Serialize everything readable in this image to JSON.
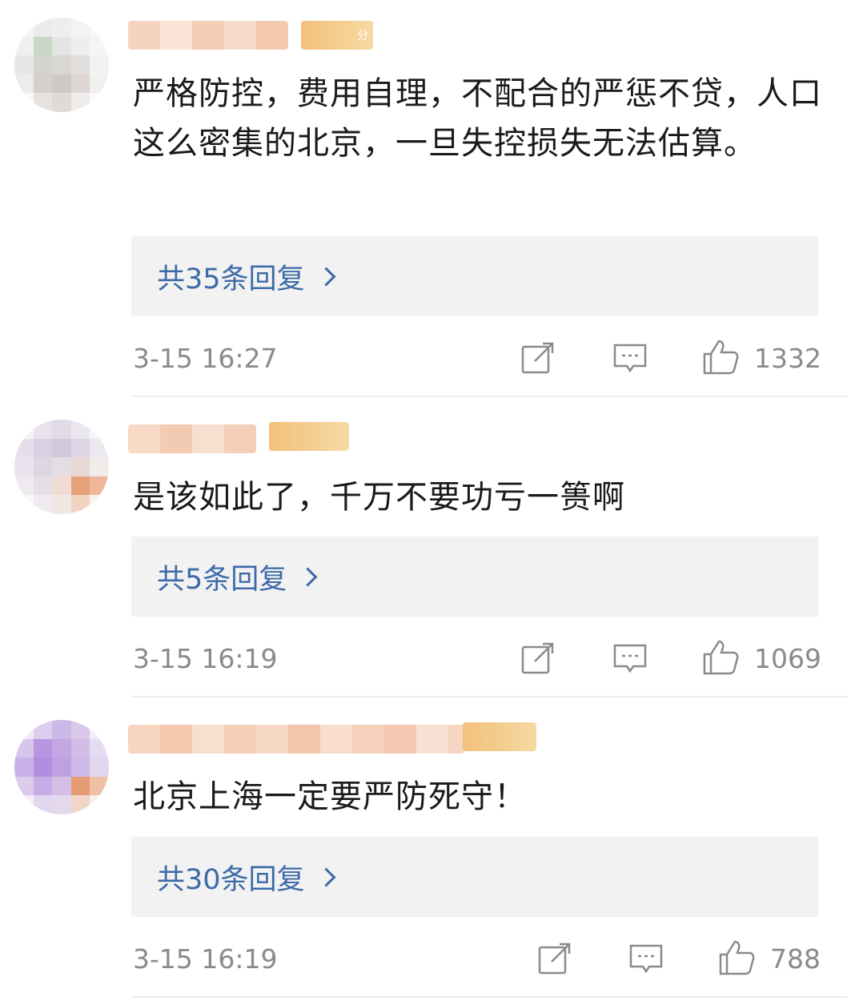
{
  "comments": [
    {
      "text": "严格防控，费用自理，不配合的严惩不贷，人口这么密集的北京，一旦失控损失无法估算。",
      "badge_text": "分",
      "replies_label": "共35条回复",
      "time": "3-15 16:27",
      "likes": "1332"
    },
    {
      "text": "是该如此了，千万不要功亏一篑啊",
      "badge_text": "",
      "replies_label": "共5条回复",
      "time": "3-15 16:19",
      "likes": "1069"
    },
    {
      "text": "北京上海一定要严防死守！",
      "badge_text": "",
      "replies_label": "共30条回复",
      "time": "3-15 16:19",
      "likes": "788"
    }
  ],
  "icons": {
    "share": "share-icon",
    "comment": "comment-icon",
    "like": "thumbs-up-icon"
  },
  "colors": {
    "reply_link": "#3d6aa8",
    "meta_gray": "#8a8a8a",
    "reply_bg": "#f2f2f2"
  }
}
